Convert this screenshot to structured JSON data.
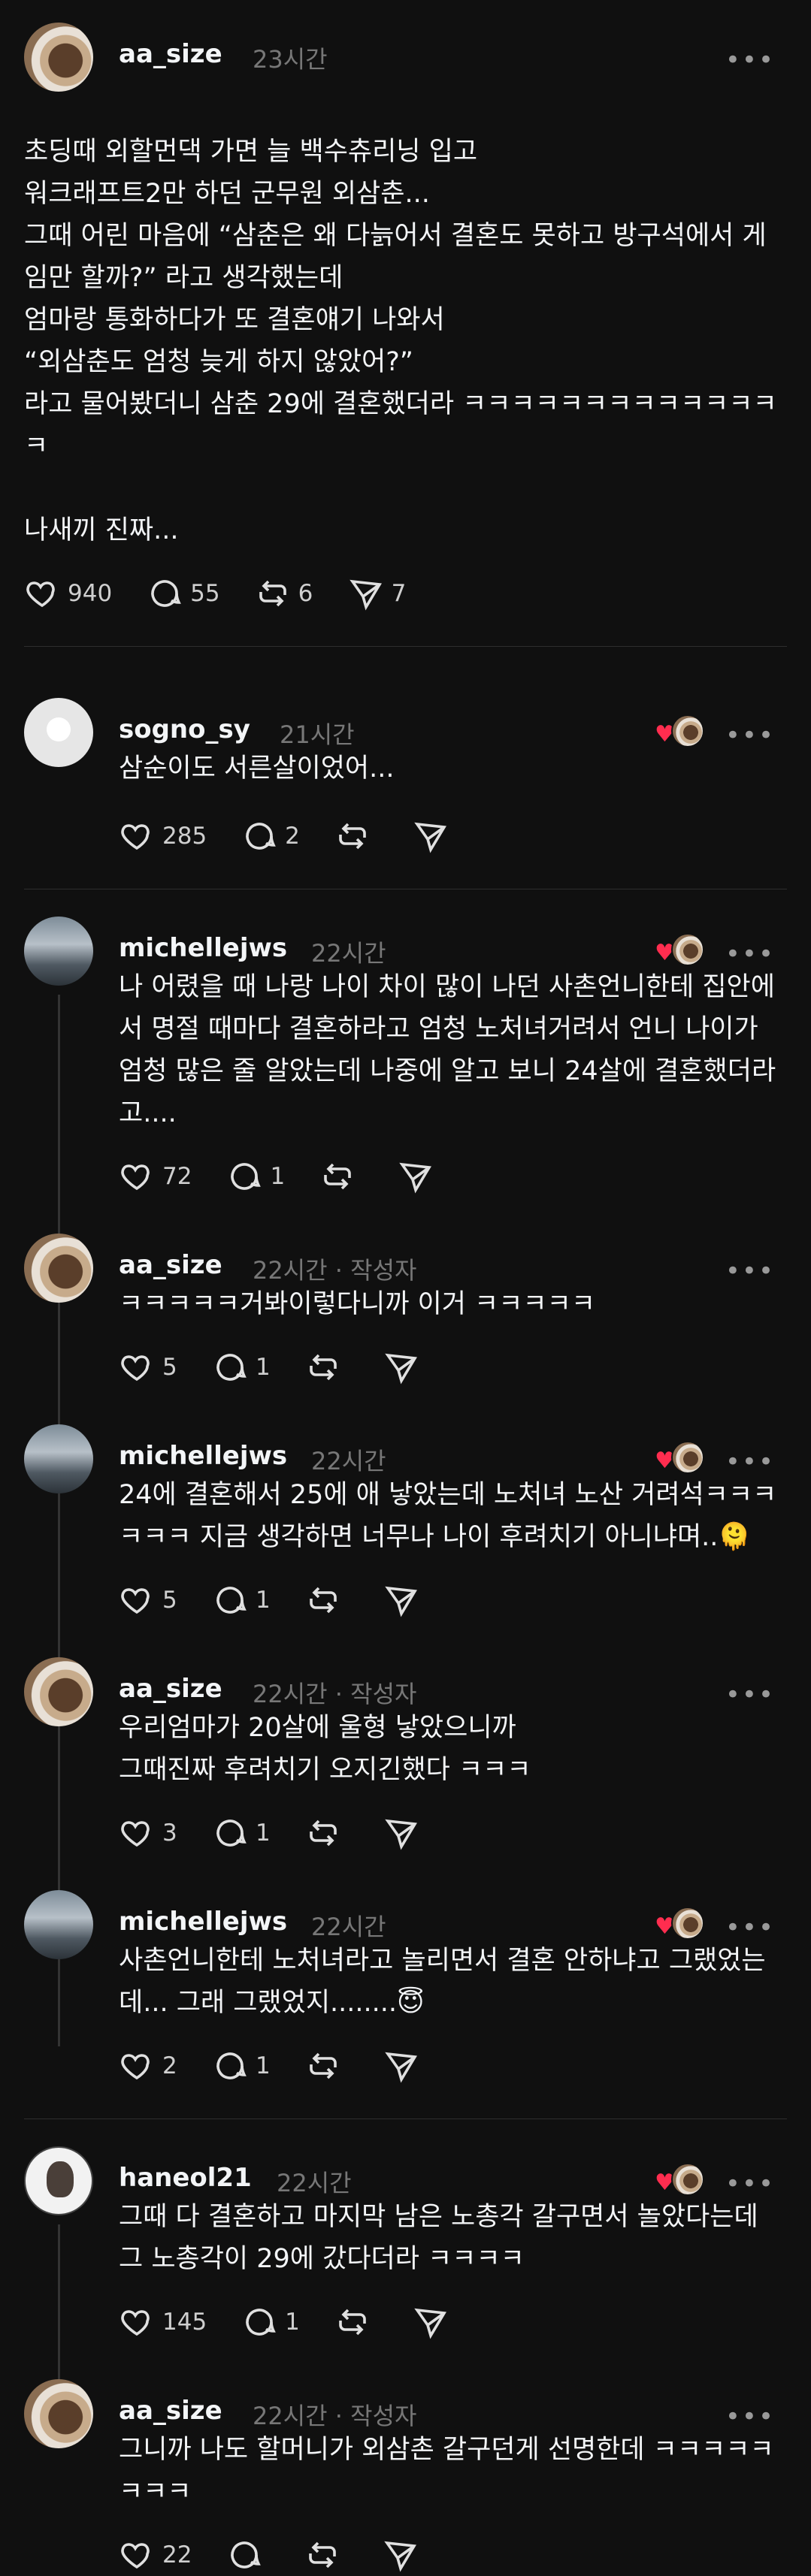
{
  "main_post": {
    "username": "aa_size",
    "time": "23시간",
    "text": "초딩때 외할먼댁 가면 늘 백수츄리닝 입고\n워크래프트2만 하던 군무원 외삼춘...\n그때 어린 마음에 “삼춘은 왜 다늙어서 결혼도 못하고 방구석에서 게임만 할까?” 라고 생각했는데\n엄마랑 통화하다가 또 결혼얘기 나와서\n“외삼춘도 엄청 늦게 하지 않았어?”\n라고 물어봤더니 삼춘 29에 결혼했더라 ㅋㅋㅋㅋㅋㅋㅋㅋㅋㅋㅋㅋㅋㅋ\n\n나새끼 진짜...",
    "likes": "940",
    "comments": "55",
    "reposts": "6",
    "shares": "7"
  },
  "replies": [
    {
      "username": "sogno_sy",
      "time": "21시간",
      "author_tag": "",
      "text": "삼순이도 서른살이었어...",
      "likes": "285",
      "comments": "2",
      "avatar": "gray",
      "liked_by_author": true
    },
    {
      "username": "michellejws",
      "time": "22시간",
      "author_tag": "",
      "text": "나 어렸을 때 나랑 나이 차이 많이 나던 사촌언니한테 집안에서 명절 때마다 결혼하라고 엄청 노처녀거려서 언니 나이가 엄청 많은 줄 알았는데 나중에 알고 보니 24살에 결혼했더라고....",
      "likes": "72",
      "comments": "1",
      "avatar": "city",
      "liked_by_author": true
    },
    {
      "username": "aa_size",
      "time": "22시간",
      "author_tag": "· 작성자",
      "text": "ㅋㅋㅋㅋㅋ거봐이렇다니까 이거 ㅋㅋㅋㅋㅋ",
      "likes": "5",
      "comments": "1",
      "avatar": "dog",
      "liked_by_author": false
    },
    {
      "username": "michellejws",
      "time": "22시간",
      "author_tag": "",
      "text": "24에 결혼해서 25에 애 낳았는데 노처녀 노산 거려석ㅋㅋㅋㅋㅋㅋ 지금 생각하면 너무나 나이 후려치기 아니냐며..🫠",
      "likes": "5",
      "comments": "1",
      "avatar": "city",
      "liked_by_author": true
    },
    {
      "username": "aa_size",
      "time": "22시간",
      "author_tag": "· 작성자",
      "text": "우리엄마가 20살에 울형 낳았으니까\n그때진짜 후려치기 오지긴했다 ㅋㅋㅋ",
      "likes": "3",
      "comments": "1",
      "avatar": "dog",
      "liked_by_author": false
    },
    {
      "username": "michellejws",
      "time": "22시간",
      "author_tag": "",
      "text": "사촌언니한테 노처녀라고 놀리면서 결혼 안하냐고 그랬었는데... 그래 그랬었지........😇",
      "likes": "2",
      "comments": "1",
      "avatar": "city",
      "liked_by_author": true
    },
    {
      "username": "haneol21",
      "time": "22시간",
      "author_tag": "",
      "text": "그때 다 결혼하고 마지막 남은 노총각 갈구면서 놀았다는데 그 노총각이 29에 갔다더라 ㅋㅋㅋㅋ",
      "likes": "145",
      "comments": "1",
      "avatar": "man",
      "liked_by_author": true
    },
    {
      "username": "aa_size",
      "time": "22시간",
      "author_tag": "· 작성자",
      "text": "그니까 나도 할머니가 외삼촌 갈구던게 선명한데 ㅋㅋㅋㅋㅋㅋㅋㅋ",
      "likes": "22",
      "comments": "",
      "avatar": "dog",
      "liked_by_author": false
    }
  ],
  "icons": {
    "like": "heart-icon",
    "comment": "comment-bubble-icon",
    "repost": "repost-icon",
    "share": "send-icon",
    "more": "more-options-icon"
  }
}
